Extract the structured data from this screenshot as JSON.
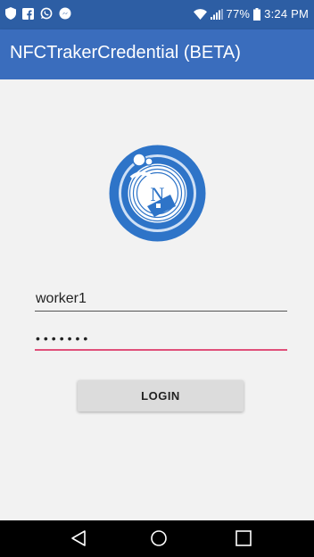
{
  "status_bar": {
    "icons_left": [
      "shield-icon",
      "facebook-icon",
      "whatsapp-icon",
      "messenger-icon"
    ],
    "icons_right": [
      "wifi-icon",
      "signal-icon",
      "battery-icon"
    ],
    "battery": "77%",
    "time": "3:24 PM"
  },
  "app_bar": {
    "title": "NFCTrakerCredential (BETA)",
    "color": "#3a6dbd"
  },
  "login": {
    "username_value": "worker1",
    "password_value": "•••••••",
    "button_label": "LOGIN",
    "accent_color": "#e0507a"
  },
  "nav_bar": {
    "buttons": [
      "back-icon",
      "home-icon",
      "recents-icon"
    ]
  }
}
